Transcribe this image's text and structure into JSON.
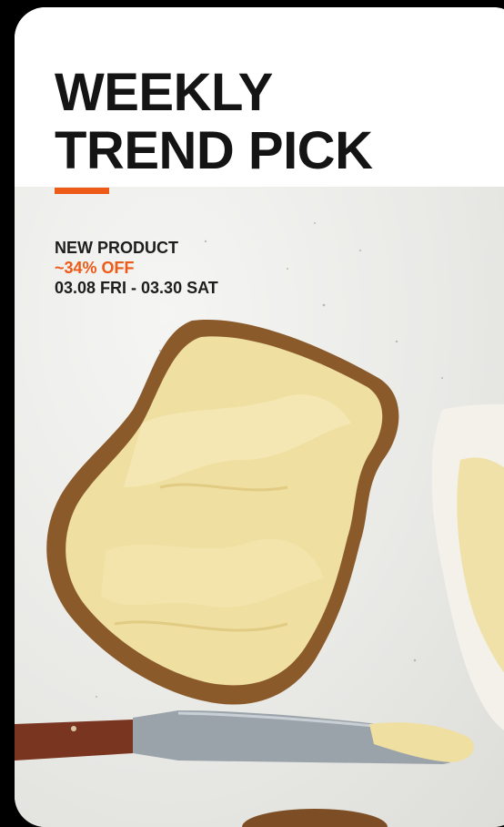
{
  "banner": {
    "title_line1": "WEEKLY",
    "title_line2": "TREND PICK",
    "tag": "NEW PRODUCT",
    "discount": "~34% OFF",
    "date_range": "03.08 FRI - 03.30 SAT"
  },
  "colors": {
    "accent": "#ee5a17",
    "text": "#141414",
    "background": "#000000",
    "card": "#ffffff"
  },
  "image": {
    "subject": "buttered-toast-photo"
  }
}
